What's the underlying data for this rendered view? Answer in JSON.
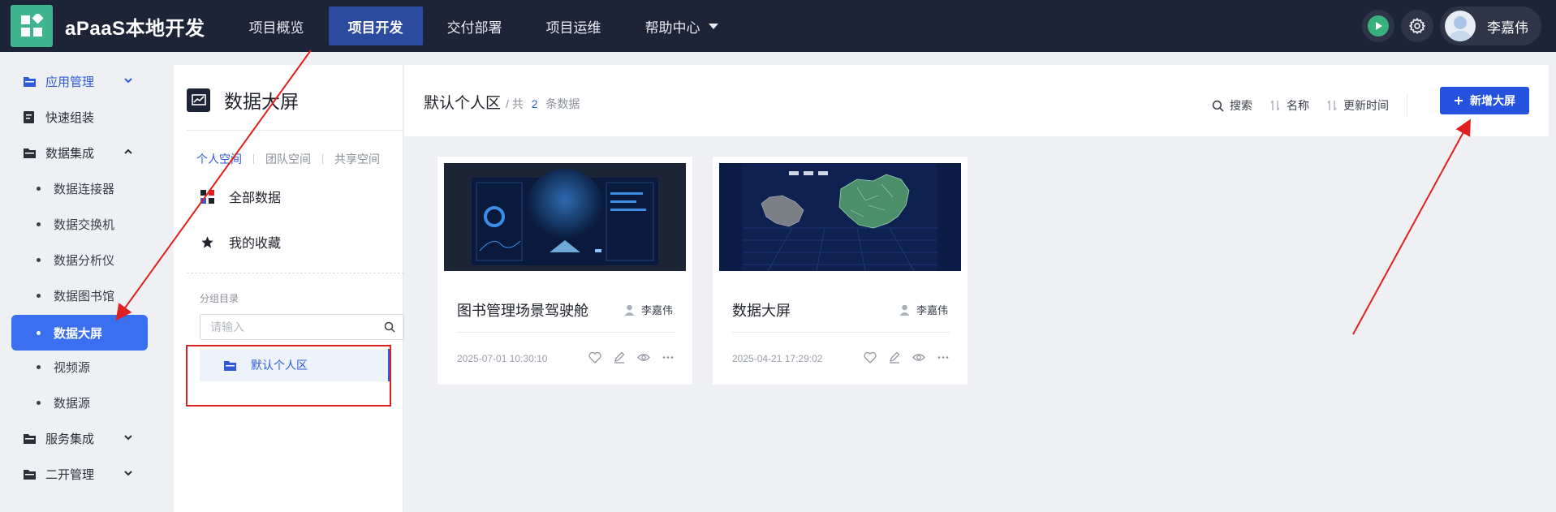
{
  "header": {
    "app_name": "aPaaS本地开发",
    "nav": [
      {
        "label": "项目概览"
      },
      {
        "label": "项目开发"
      },
      {
        "label": "交付部署"
      },
      {
        "label": "项目运维"
      },
      {
        "label": "帮助中心"
      }
    ],
    "user_name": "李嘉伟"
  },
  "sidebar": {
    "items": [
      {
        "label": "应用管理"
      },
      {
        "label": "快速组装"
      },
      {
        "label": "数据集成"
      },
      {
        "label": "服务集成"
      },
      {
        "label": "二开管理"
      }
    ],
    "sub_items": [
      {
        "label": "数据连接器"
      },
      {
        "label": "数据交换机"
      },
      {
        "label": "数据分析仪"
      },
      {
        "label": "数据图书馆"
      },
      {
        "label": "数据大屏"
      },
      {
        "label": "视频源"
      },
      {
        "label": "数据源"
      }
    ]
  },
  "panel": {
    "title": "数据大屏",
    "space_tabs": [
      {
        "label": "个人空间"
      },
      {
        "label": "团队空间"
      },
      {
        "label": "共享空间"
      }
    ],
    "all_data": "全部数据",
    "favorites": "我的收藏",
    "group_label": "分组目录",
    "search_placeholder": "请输入",
    "folder": "默认个人区"
  },
  "content": {
    "title": "默认个人区",
    "count_prefix": "/ 共",
    "count": "2",
    "count_suffix": "条数据",
    "tools": {
      "search": "搜索",
      "name": "名称",
      "updated": "更新时间"
    },
    "add_button": "新增大屏",
    "cards": [
      {
        "title": "图书管理场景驾驶舱",
        "author": "李嘉伟",
        "date": "2025-07-01 10:30:10"
      },
      {
        "title": "数据大屏",
        "author": "李嘉伟",
        "date": "2025-04-21 17:29:02"
      }
    ]
  },
  "colors": {
    "accent": "#2652e0",
    "nav_bg": "#1d2438",
    "sidebar_active": "#3a6ff0",
    "annotation": "#e02020"
  }
}
